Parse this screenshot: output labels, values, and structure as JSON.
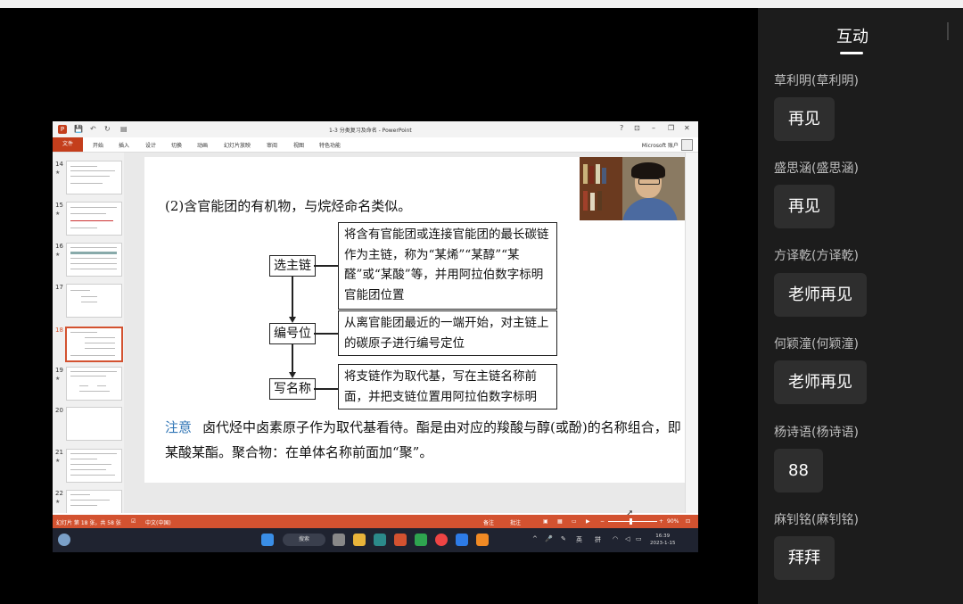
{
  "ppt": {
    "doc_title": "1-3 分类复习及命名 - PowerPoint",
    "ribbon_tabs": [
      "文件",
      "开始",
      "插入",
      "设计",
      "切换",
      "动画",
      "幻灯片放映",
      "审阅",
      "视图",
      "特色功能"
    ],
    "account": "Microsoft 账户",
    "window_controls": [
      "?",
      "⊡",
      "–",
      "❐",
      "✕"
    ],
    "thumb_numbers": [
      "14",
      "15",
      "16",
      "17",
      "18",
      "19",
      "20",
      "21",
      "22"
    ],
    "active_slide": "18",
    "status": {
      "slide_info": "幻灯片 第 18 张，共 58 张",
      "language": "中文(中国)",
      "notes": "备注",
      "comments": "批注",
      "zoom": "90%"
    }
  },
  "slide": {
    "heading": "(2)含官能团的有机物，与烷烃命名类似。",
    "steps": [
      {
        "label": "选主链",
        "desc": "将含有官能团或连接官能团的最长碳链作为主链，称为“某烯”“某醇”“某醛”或“某酸”等，并用阿拉伯数字标明官能团位置"
      },
      {
        "label": "编号位",
        "desc": "从离官能团最近的一端开始，对主链上的碳原子进行编号定位"
      },
      {
        "label": "写名称",
        "desc": "将支链作为取代基，写在主链名称前面，并把支链位置用阿拉伯数字标明"
      }
    ],
    "note_keyword": "注意",
    "note_text": "卤代烃中卤素原子作为取代基看待。酯是由对应的羧酸与醇(或酚)的名称组合，即某酸某酯。聚合物：在单体名称前面加“聚”。"
  },
  "taskbar": {
    "search_label": "搜索",
    "ime_lang": "英",
    "ime_mode": "拼",
    "time": "16:39",
    "date": "2023-1-15"
  },
  "chat": {
    "title": "互动",
    "messages": [
      {
        "name": "草利明(草利明)",
        "text": "再见"
      },
      {
        "name": "盛思涵(盛思涵)",
        "text": "再见"
      },
      {
        "name": "方译乾(方译乾)",
        "text": "老师再见"
      },
      {
        "name": "何颖潼(何颖潼)",
        "text": "老师再见"
      },
      {
        "name": "杨诗语(杨诗语)",
        "text": "88"
      },
      {
        "name": "麻钊铭(麻钊铭)",
        "text": "拜拜"
      }
    ]
  },
  "colors": {
    "ppt_accent": "#d35230",
    "note_keyword": "#2f74b5",
    "panel_bg": "#1c1c1c",
    "bubble_bg": "#2e2e2e"
  }
}
